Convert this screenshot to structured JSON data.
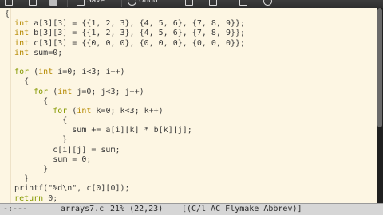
{
  "toolbar": {
    "save_label": "Save",
    "undo_label": "Undo"
  },
  "editor": {
    "filename": "arrays7.c",
    "lines": [
      "{",
      "  int a[3][3] = {{1, 2, 3}, {4, 5, 6}, {7, 8, 9}};",
      "  int b[3][3] = {{1, 2, 3}, {4, 5, 6}, {7, 8, 9}};",
      "  int c[3][3] = {{0, 0, 0}, {0, 0, 0}, {0, 0, 0}};",
      "  int sum=0;",
      "",
      "  for (int i=0; i<3; i++)",
      "    {",
      "      for (int j=0; j<3; j++)",
      "        {",
      "          for (int k=0; k<3; k++)",
      "            {",
      "              sum += a[i][k] * b[k][j];",
      "            }",
      "          c[i][j] = sum;",
      "          sum = 0;",
      "        }",
      "    }",
      "  printf(\"%d\\n\", c[0][0]);",
      "  return 0;"
    ]
  },
  "modeline": {
    "status": "-:---",
    "buffer": "arrays7.c",
    "position": "21% (22,23)",
    "modes": "[(C/l AC Flymake Abbrev)]"
  }
}
